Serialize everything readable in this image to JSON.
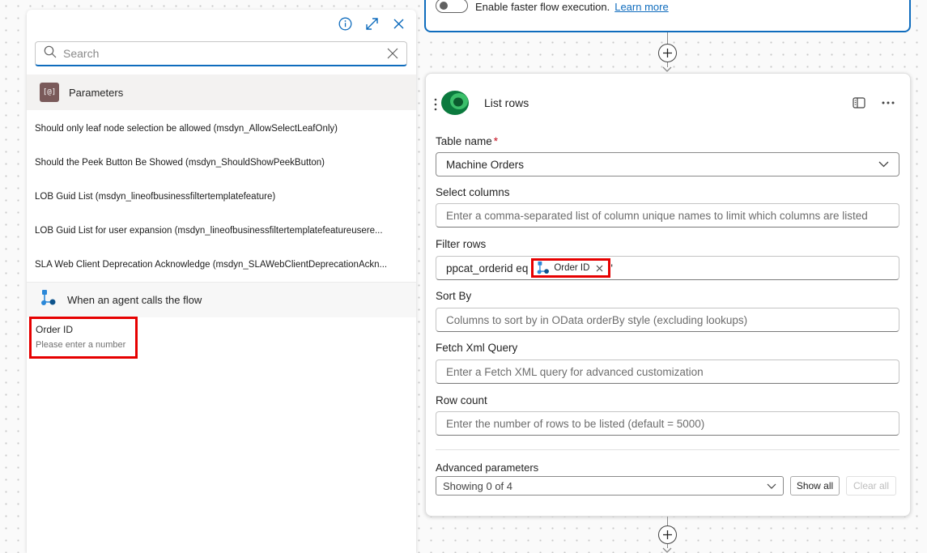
{
  "left_panel": {
    "search": {
      "placeholder": "Search",
      "value": ""
    },
    "parameters_header": "Parameters",
    "parameters_icon_text": "[@]",
    "parameters": [
      "Should only leaf node selection be allowed (msdyn_AllowSelectLeafOnly)",
      "Should the Peek Button Be Showed (msdyn_ShouldShowPeekButton)",
      "LOB Guid List (msdyn_lineofbusinessfiltertemplatefeature)",
      "LOB Guid List for user expansion (msdyn_lineofbusinessfiltertemplatefeatureusere...",
      "SLA Web Client Deprecation Acknowledge (msdyn_SLAWebClientDeprecationAckn..."
    ],
    "trigger_header": "When an agent calls the flow",
    "trigger_output": {
      "title": "Order ID",
      "subtitle": "Please enter a number"
    }
  },
  "top_card": {
    "toggle_label": "Enable faster flow execution.",
    "learn_more": "Learn more"
  },
  "main_card": {
    "title": "List rows",
    "fields": {
      "table_name": {
        "label": "Table name",
        "required_mark": "*",
        "value": "Machine Orders"
      },
      "select_columns": {
        "label": "Select columns",
        "placeholder": "Enter a comma-separated list of column unique names to limit which columns are listed"
      },
      "filter_rows": {
        "label": "Filter rows",
        "prefix": "ppcat_orderid eq",
        "token": "Order ID",
        "suffix": "'"
      },
      "sort_by": {
        "label": "Sort By",
        "placeholder": "Columns to sort by in OData orderBy style (excluding lookups)"
      },
      "fetch_xml": {
        "label": "Fetch Xml Query",
        "placeholder": "Enter a Fetch XML query for advanced customization"
      },
      "row_count": {
        "label": "Row count",
        "placeholder": "Enter the number of rows to be listed (default = 5000)"
      }
    },
    "advanced": {
      "label": "Advanced parameters",
      "selected": "Showing 0 of 4",
      "show_all": "Show all",
      "clear_all": "Clear all"
    }
  },
  "colors": {
    "accent": "#0f6cbd",
    "highlight": "#e60000",
    "dataverse_green": "#0b7a3e"
  }
}
